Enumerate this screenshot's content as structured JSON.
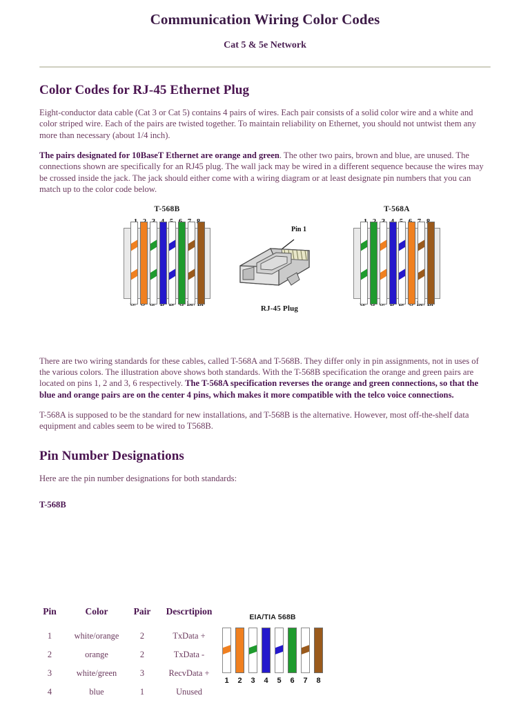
{
  "header": {
    "title": "Communication Wiring Color Codes",
    "subtitle": "Cat 5 & 5e Network"
  },
  "colors": {
    "heading": "#4a1450",
    "body_text": "#6b3a5e",
    "rule": "#cfcfc0",
    "orange": "#f08020",
    "green": "#1f9b2e",
    "blue": "#2418cc",
    "brown": "#9a5a1c",
    "wire_box_bg": "#e9e9e9"
  },
  "section1": {
    "heading": "Color Codes for RJ-45 Ethernet Plug",
    "paragraph1": "Eight-conductor data cable (Cat 3 or Cat 5) contains 4 pairs of wires. Each pair consists of a solid color wire and a white and color striped wire. Each of the pairs are twisted together. To maintain reliability on Ethernet, you should not untwist them any more than necessary (about 1/4 inch).",
    "paragraph2_bold": "The pairs designated for 10BaseT Ethernet are orange and green",
    "paragraph2_rest": ". The other two pairs, brown and blue, are unused. The connections shown are specifically for an RJ45 plug. The wall jack may be wired in a different sequence because the wires may be crossed inside the jack. The jack should either come with a wiring diagram or at least designate pin numbers that you can match up to the color code below."
  },
  "diagrams": {
    "t568b": {
      "title": "T-568B",
      "pins": [
        "1",
        "2",
        "3",
        "4",
        "5",
        "6",
        "7",
        "8"
      ],
      "wires": [
        {
          "color": "orange",
          "type": "striped"
        },
        {
          "color": "orange",
          "type": "solid"
        },
        {
          "color": "green",
          "type": "striped"
        },
        {
          "color": "blue",
          "type": "solid"
        },
        {
          "color": "blue",
          "type": "striped"
        },
        {
          "color": "green",
          "type": "solid"
        },
        {
          "color": "brown",
          "type": "striped"
        },
        {
          "color": "brown",
          "type": "solid"
        }
      ],
      "labels": [
        "O/",
        "O",
        "G/",
        "B",
        "B/",
        "G",
        "Br/",
        "Br"
      ]
    },
    "t568a": {
      "title": "T-568A",
      "pins": [
        "1",
        "2",
        "3",
        "4",
        "5",
        "6",
        "7",
        "8"
      ],
      "wires": [
        {
          "color": "green",
          "type": "striped"
        },
        {
          "color": "green",
          "type": "solid"
        },
        {
          "color": "orange",
          "type": "striped"
        },
        {
          "color": "blue",
          "type": "solid"
        },
        {
          "color": "blue",
          "type": "striped"
        },
        {
          "color": "orange",
          "type": "solid"
        },
        {
          "color": "brown",
          "type": "striped"
        },
        {
          "color": "brown",
          "type": "solid"
        }
      ],
      "labels": [
        "G/",
        "G",
        "O/",
        "B",
        "B/",
        "O",
        "Br/",
        "Br"
      ]
    },
    "plug": {
      "pin1_label": "Pin 1",
      "caption": "RJ-45 Plug"
    }
  },
  "section2": {
    "paragraph1_part1": "There are two wiring standards for these cables, called T-568A and T-568B. They differ only in pin assignments, not in uses of the various colors. The illustration above shows both standards.  With the T-568B specification the orange and green pairs are located on pins 1, 2 and 3, 6 respectively. ",
    "paragraph1_bold": "The T-568A specification reverses the orange and green connections, so that the blue and orange pairs are on the center 4 pins, which makes it more compatible with the telco voice connections.",
    "paragraph2": "T-568A is supposed to be the standard for new installations, and T-568B is the alternative. However, most off-the-shelf data equipment and cables seem to be wired to T568B."
  },
  "section3": {
    "heading": "Pin Number Designations",
    "intro": "Here are the pin number designations for both standards:",
    "standard_label": "T-568B",
    "table": {
      "headers": [
        "Pin",
        "Color",
        "Pair",
        "Descrtipion"
      ],
      "rows": [
        {
          "pin": "1",
          "color": "white/orange",
          "pair": "2",
          "description": "TxData +"
        },
        {
          "pin": "2",
          "color": "orange",
          "pair": "2",
          "description": "TxData -"
        },
        {
          "pin": "3",
          "color": "white/green",
          "pair": "3",
          "description": "RecvData +"
        },
        {
          "pin": "4",
          "color": "blue",
          "pair": "1",
          "description": "Unused"
        }
      ]
    }
  },
  "eia_diagram": {
    "title": "EIA/TIA 568B",
    "numbers": [
      "1",
      "2",
      "3",
      "4",
      "5",
      "6",
      "7",
      "8"
    ],
    "wires": [
      {
        "color": "orange",
        "type": "striped"
      },
      {
        "color": "orange",
        "type": "solid"
      },
      {
        "color": "green",
        "type": "striped"
      },
      {
        "color": "blue",
        "type": "solid"
      },
      {
        "color": "blue",
        "type": "striped"
      },
      {
        "color": "green",
        "type": "solid"
      },
      {
        "color": "brown",
        "type": "striped"
      },
      {
        "color": "brown",
        "type": "solid"
      }
    ]
  }
}
